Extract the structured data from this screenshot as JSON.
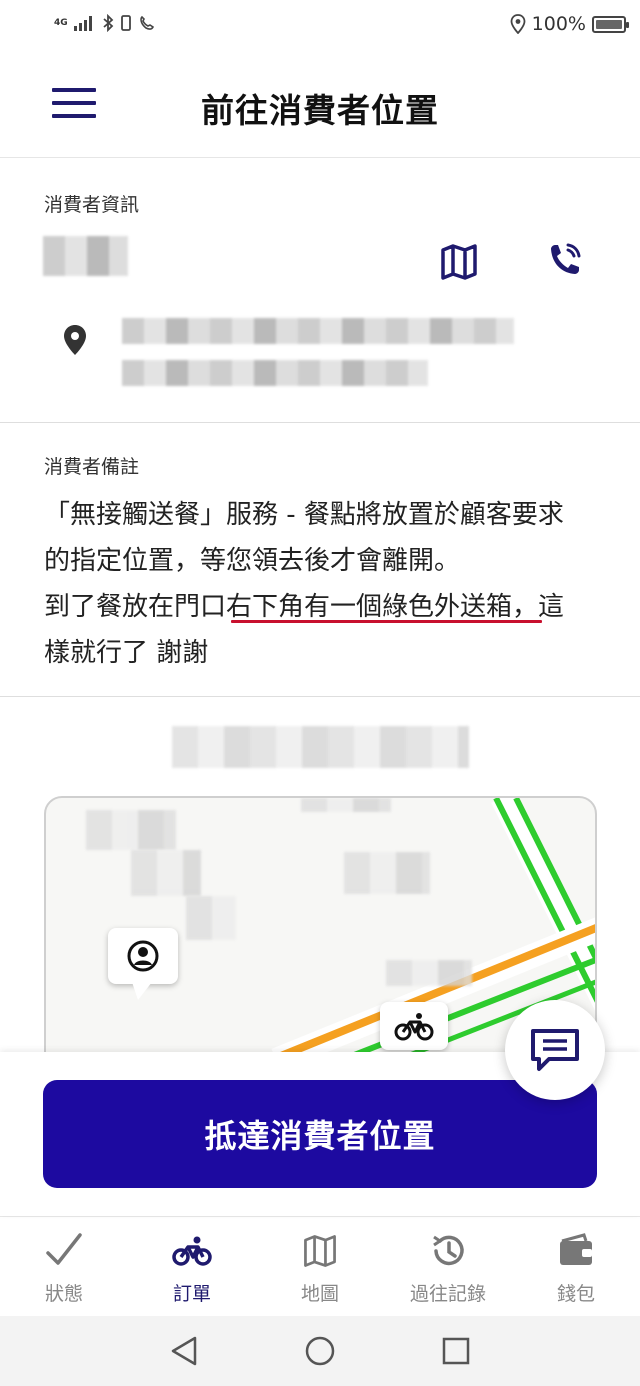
{
  "status_bar": {
    "network": "4G",
    "battery_percent": "100%"
  },
  "header": {
    "title": "前往消費者位置"
  },
  "customer_info": {
    "section_label": "消費者資訊"
  },
  "customer_notes": {
    "section_label": "消費者備註",
    "lines": [
      "「無接觸送餐」服務 - 餐點將放置於顧客要求",
      "的指定位置，等您領去後才會離開。",
      "到了餐放在門口右下角有一個綠色外送箱，這",
      "樣就行了 謝謝"
    ]
  },
  "primary_action": {
    "label": "抵達消費者位置"
  },
  "tabs": [
    {
      "label": "狀態",
      "icon": "check-icon",
      "active": false
    },
    {
      "label": "訂單",
      "icon": "bicycle-icon",
      "active": true
    },
    {
      "label": "地圖",
      "icon": "map-icon",
      "active": false
    },
    {
      "label": "過往記錄",
      "icon": "history-icon",
      "active": false
    },
    {
      "label": "錢包",
      "icon": "wallet-icon",
      "active": false
    }
  ],
  "colors": {
    "brand": "#1d0aa0",
    "icon_navy": "#1f1a6e",
    "highlight_underline": "#c8102e",
    "route_green": "#2ecc2e",
    "route_orange": "#f5a020"
  }
}
